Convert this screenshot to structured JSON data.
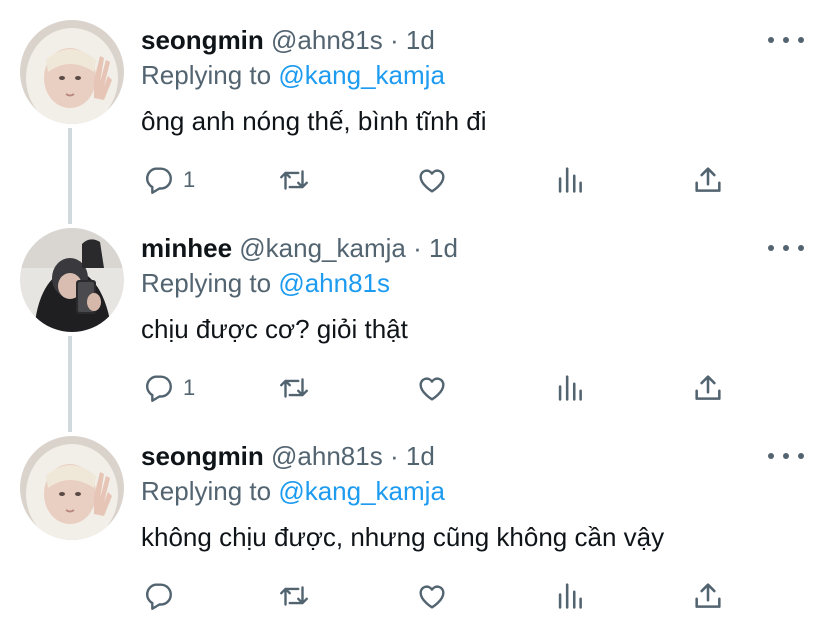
{
  "thread": [
    {
      "name": "seongmin",
      "handle": "@ahn81s",
      "dot": "·",
      "time": "1d",
      "replying_label": "Replying to",
      "replying_handle": "@kang_kamja",
      "text": "ông anh nóng thế, bình tĩnh đi",
      "reply_count": "1",
      "avatar_icon": "avatar-light-hood"
    },
    {
      "name": "minhee",
      "handle": "@kang_kamja",
      "dot": "·",
      "time": "1d",
      "replying_label": "Replying to",
      "replying_handle": "@ahn81s",
      "text": "chịu được cơ? giỏi thật",
      "reply_count": "1",
      "avatar_icon": "avatar-dark-hood"
    },
    {
      "name": "seongmin",
      "handle": "@ahn81s",
      "dot": "·",
      "time": "1d",
      "replying_label": "Replying to",
      "replying_handle": "@kang_kamja",
      "text": "không chịu được, nhưng cũng không cần vậy",
      "reply_count": "",
      "avatar_icon": "avatar-light-hood"
    }
  ],
  "colors": {
    "text": "#0f1419",
    "secondary": "#536471",
    "accent": "#1d9bf0",
    "thread_line": "#cfd9de"
  },
  "icons": [
    "more-icon",
    "reply-icon",
    "retweet-icon",
    "like-icon",
    "stats-icon",
    "share-icon"
  ]
}
